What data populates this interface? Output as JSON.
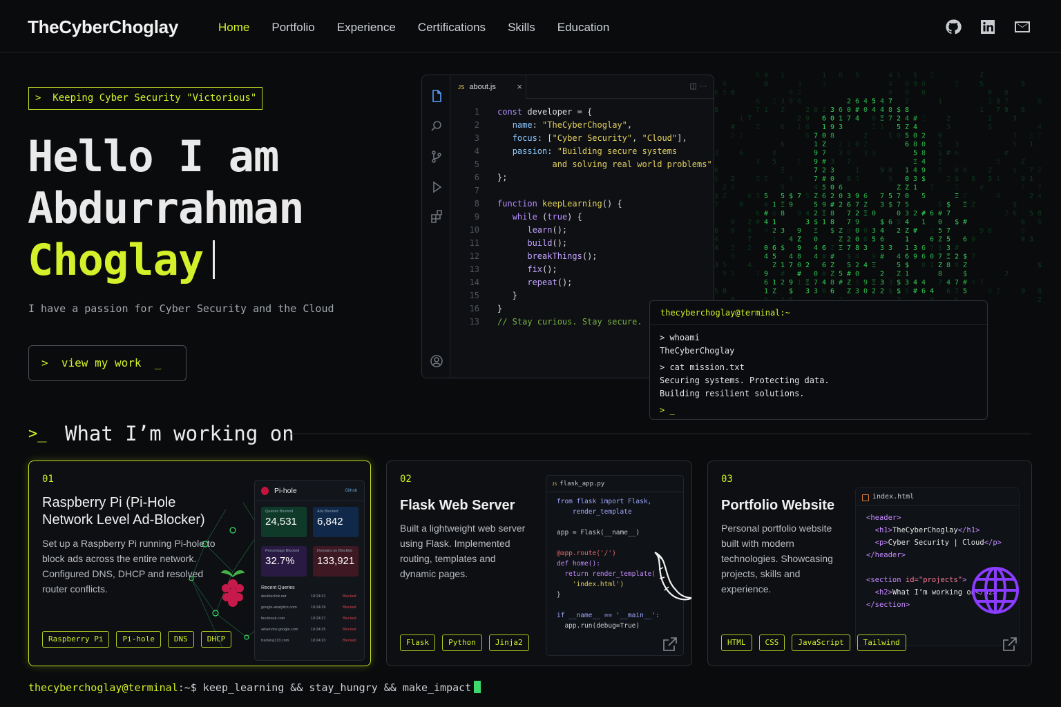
{
  "brand": "TheCyberChoglay",
  "nav": {
    "links": [
      "Home",
      "Portfolio",
      "Experience",
      "Certifications",
      "Skills",
      "Education"
    ],
    "active": "Home",
    "icons": [
      "github-icon",
      "linkedin-icon",
      "mail-icon"
    ]
  },
  "hero": {
    "tagline": ">  Keeping Cyber Security \"Victorious\"",
    "line1": "Hello I am",
    "line2": "Abdurrahman",
    "line3": "Choglay",
    "subtitle": "I have a passion for Cyber Security and the Cloud",
    "cta": ">  view my work  _"
  },
  "editor": {
    "tab_badge": "JS",
    "tab_name": "about.js",
    "tab_close": "×",
    "tools": "◫  ···",
    "line_numbers": [
      "1",
      "2",
      "3",
      "4",
      "5",
      "6",
      "7",
      "8",
      "9",
      "10",
      "11",
      "12",
      "13",
      "14",
      "15",
      "16",
      "13"
    ],
    "code": {
      "l1a": "const",
      "l1b": " developer = {",
      "l2a": "name",
      "l2b": ": ",
      "l2c": "\"TheCyberChoglay\"",
      "l2d": ",",
      "l3a": "focus",
      "l3b": ": [",
      "l3c": "\"Cyber Security\"",
      "l3d": ", ",
      "l3e": "\"Cloud\"",
      "l3f": "],",
      "l4a": "passion",
      "l4b": ": ",
      "l4c": "\"Building secure systems",
      "l5a": "and solving real world problems\"",
      "l5b": ",",
      "l6": "};",
      "l8a": "function",
      "l8b": " keepLearning",
      "l8c": "() {",
      "l9a": "while",
      "l9b": " (",
      "l9c": "true",
      "l9d": ") {",
      "l10": "learn",
      "l11": "build",
      "l12": "breakThings",
      "l13": "fix",
      "l14": "repeat",
      "call_suffix": "();",
      "l15": "}",
      "l16": "}",
      "l18": "// Stay curious. Stay secure."
    }
  },
  "terminal": {
    "header": "thecyberchoglay@terminal:~",
    "lines": [
      "> whoami",
      "TheCyberChoglay",
      "> cat mission.txt",
      "Securing systems. Protecting data.",
      "Building resilient solutions."
    ],
    "prompt": "> _"
  },
  "section": {
    "prompt": ">_",
    "title": "What I’m working on"
  },
  "projects": [
    {
      "num": "01",
      "title_lines": [
        "Raspberry Pi (Pi-Hole",
        "Network Level Ad-Blocker)"
      ],
      "desc_lines": [
        "Set up a Raspberry Pi running Pi-hole to",
        "block ads across the entire network.",
        "Configured DNS, DHCP and resolved",
        "router conflicts."
      ],
      "tags": [
        "Raspberry Pi",
        "Pi-hole",
        "DNS",
        "DHCP"
      ]
    },
    {
      "num": "02",
      "title_lines": [
        "Flask Web Server"
      ],
      "desc_lines": [
        "Built a lightweight web server",
        "using Flask. Implemented",
        "routing, templates and",
        "dynamic pages."
      ],
      "tags": [
        "Flask",
        "Python",
        "Jinja2"
      ]
    },
    {
      "num": "03",
      "title_lines": [
        "Portfolio Website"
      ],
      "desc_lines": [
        "Personal portfolio website",
        "built with modern",
        "technologies. Showcasing",
        "projects, skills and",
        "experience."
      ],
      "tags": [
        "HTML",
        "CSS",
        "JavaScript",
        "Tailwind"
      ]
    }
  ],
  "pihole": {
    "title": "Pi-hole",
    "link": "Github",
    "stats": [
      {
        "label": "Queries Blocked",
        "value": "24,531"
      },
      {
        "label": "Ads Blocked",
        "value": "6,842"
      },
      {
        "label": "Percentage Blocked",
        "value": "32.7%"
      },
      {
        "label": "Domains on Blocklist",
        "value": "133,921"
      }
    ],
    "recent_header": "Recent Queries",
    "recent": [
      [
        "doubleclick.net",
        "10:24:31",
        "Blocked"
      ],
      [
        "google-analytics.com",
        "10:24:29",
        "Blocked"
      ],
      [
        "facebook.com",
        "10:24:27",
        "Blocked"
      ],
      [
        "adservice.google.com",
        "10:24:25",
        "Blocked"
      ],
      [
        "tracking133.com",
        "10:24:23",
        "Blocked"
      ]
    ]
  },
  "flask_code": {
    "tab": "flask_app.py",
    "badge": "JS",
    "lines": [
      "from flask import Flask,",
      "    render_template",
      "",
      "app = Flask(__name__)",
      "",
      "@app.route('/')",
      "def home():",
      "  return render_template(",
      "    'index.html')",
      "}",
      "",
      "if __name__ == '__main__':",
      "  app.run(debug=True)"
    ]
  },
  "html_code": {
    "tab": "index.html",
    "l1": "<header>",
    "l2a": "<h1>",
    "l2b": "TheCyberChoglay",
    "l2c": "</h1>",
    "l3a": "<p>",
    "l3b": "Cyber Security | Cloud",
    "l3c": "</p>",
    "l4": "</header>",
    "l6a": "<section ",
    "l6b": "id=\"projects\"",
    "l6c": ">",
    "l7a": "<h2>",
    "l7b": "What I’m working on",
    "l7c": "</h2>",
    "l8": "</section>"
  },
  "footer": {
    "user": "thecyberchoglay@terminal",
    "path": ":~$ ",
    "command": "keep_learning && stay_hungry && make_impact"
  },
  "colors": {
    "accent": "#d4f02a",
    "background": "#0a0b0d",
    "matrix": "#2fd65a",
    "purple": "#8a3cff"
  }
}
